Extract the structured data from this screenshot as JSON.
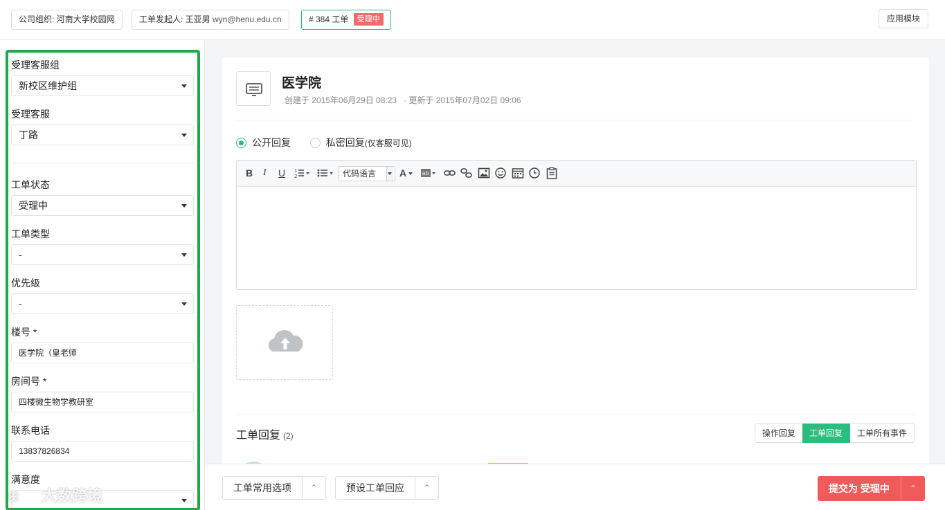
{
  "topbar": {
    "org_label": "公司组织: 河南大学校园网",
    "requester_label": "工单发起人: 王亚男",
    "requester_email": "wyn@henu.edu.cn",
    "ticket_number": "# 384 工单",
    "ticket_status_badge": "受理中",
    "app_module_label": "应用模块"
  },
  "sidebar": {
    "group_label": "受理客服组",
    "group_value": "新校区维护组",
    "agent_label": "受理客服",
    "agent_value": "丁路",
    "status_label": "工单状态",
    "status_value": "受理中",
    "type_label": "工单类型",
    "type_value": "-",
    "priority_label": "优先级",
    "priority_value": "-",
    "building_label": "楼号 *",
    "building_value": "医学院（皇老师",
    "room_label": "房间号 *",
    "room_value": "四楼微生物学教研室",
    "phone_label": "联系电话",
    "phone_value": "13837826834",
    "satisfaction_label": "满意度"
  },
  "ticket": {
    "title": "医学院",
    "created": "创建于 2015年06月29日 08:23",
    "updated": "· 更新于 2015年07月02日 09:06"
  },
  "reply": {
    "public_label": "公开回复",
    "private_label": "私密回复",
    "private_note": "(仅客服可见)",
    "code_lang_label": "代码语言"
  },
  "replies": {
    "title": "工单回复",
    "count": "(2)",
    "tabs": [
      "操作回复",
      "工单回复",
      "工单所有事件"
    ]
  },
  "bottom": {
    "common_options": "工单常用选项",
    "preset_reply": "预设工单回应",
    "submit_label": "提交为 受理中"
  },
  "watermark": {
    "text": "大数跨境"
  },
  "colors": {
    "accent_green": "#2bbd7e",
    "status_red": "#f16b6b",
    "frame_green": "#20a847",
    "submit_red": "#f05a5a"
  }
}
